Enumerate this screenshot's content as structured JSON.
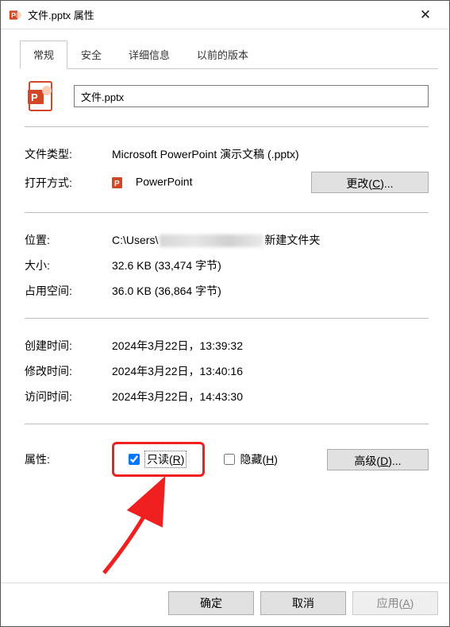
{
  "window": {
    "title": "文件.pptx 属性"
  },
  "tabs": {
    "general": "常规",
    "security": "安全",
    "details": "详细信息",
    "previous": "以前的版本"
  },
  "file": {
    "name": "文件.pptx"
  },
  "fields": {
    "type_label": "文件类型:",
    "type_value": "Microsoft PowerPoint 演示文稿 (.pptx)",
    "openwith_label": "打开方式:",
    "openwith_value": "PowerPoint",
    "change_btn": "更改(C)...",
    "location_label": "位置:",
    "location_prefix": "C:\\Users\\",
    "location_suffix": "新建文件夹",
    "size_label": "大小:",
    "size_value": "32.6 KB (33,474 字节)",
    "disk_label": "占用空间:",
    "disk_value": "36.0 KB (36,864 字节)",
    "created_label": "创建时间:",
    "created_value": "2024年3月22日，13:39:32",
    "modified_label": "修改时间:",
    "modified_value": "2024年3月22日，13:40:16",
    "accessed_label": "访问时间:",
    "accessed_value": "2024年3月22日，14:43:30",
    "attr_label": "属性:",
    "readonly_label": "只读(R)",
    "hidden_label": "隐藏(H)",
    "advanced_btn": "高级(D)..."
  },
  "footer": {
    "ok": "确定",
    "cancel": "取消",
    "apply": "应用(A)"
  }
}
